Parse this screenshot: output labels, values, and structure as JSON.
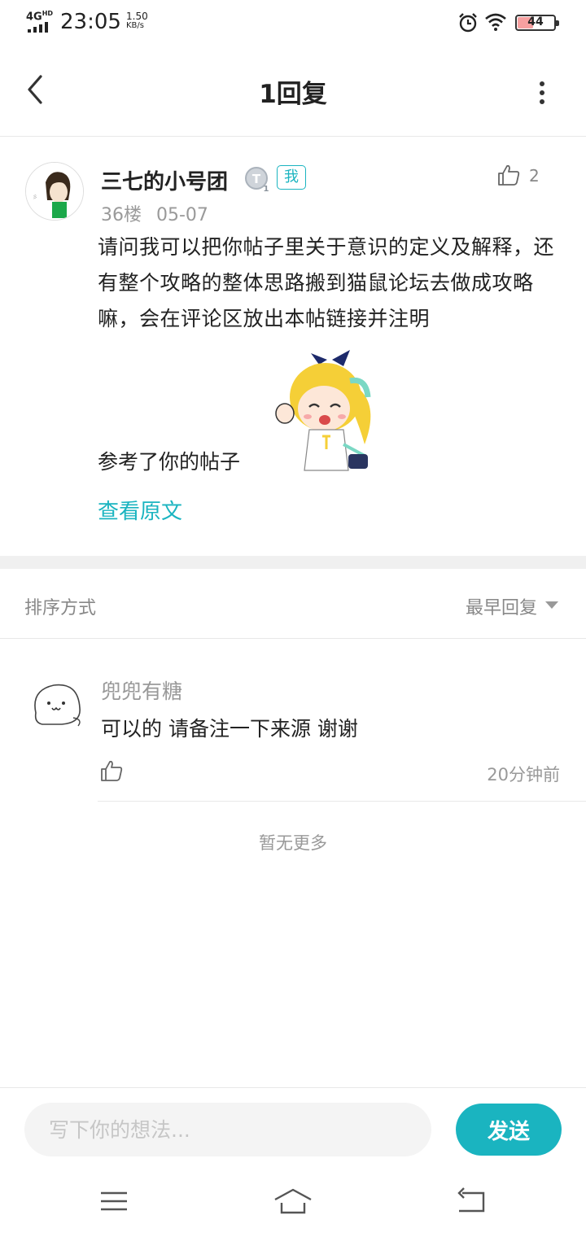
{
  "status_bar": {
    "network": "4G",
    "network_sup": "HD",
    "time": "23:05",
    "speed_value": "1.50",
    "speed_unit": "KB/s",
    "battery": "44",
    "battery_level": 0.44
  },
  "header": {
    "title": "1回复"
  },
  "post": {
    "author": "三七的小号团",
    "me_badge": "我",
    "like_count": "2",
    "floor": "36楼",
    "date": "05-07",
    "content": "请问我可以把你帖子里关于意识的定义及解释，还有整个攻略的整体思路搬到猫鼠论坛去做成攻略嘛，会在评论区放出本帖链接并注明",
    "content_tail": "参考了你的帖子",
    "view_original": "查看原文"
  },
  "sort": {
    "label": "排序方式",
    "selected": "最早回复"
  },
  "reply": {
    "author": "兜兜有糖",
    "text": "可以的 请备注一下来源 谢谢",
    "time": "20分钟前"
  },
  "no_more": "暂无更多",
  "input": {
    "placeholder": "写下你的想法...",
    "send_label": "发送"
  },
  "colors": {
    "accent": "#1ab4c0"
  }
}
